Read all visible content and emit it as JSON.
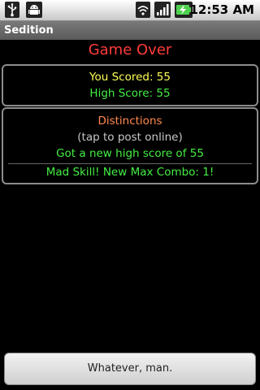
{
  "status_bar": {
    "time": "12:53 AM",
    "icons": [
      "usb-icon",
      "android-debug-icon",
      "wifi-icon",
      "signal-icon",
      "battery-charging-icon"
    ]
  },
  "app": {
    "title": "Sedition"
  },
  "game": {
    "heading": "Game Over",
    "you_scored": "You Scored: 55",
    "high_score": "High Score: 55"
  },
  "distinctions": {
    "title": "Distinctions",
    "hint": "(tap to post online)",
    "items": [
      "Got a new high score of 55",
      "Mad Skill! New Max Combo: 1!"
    ]
  },
  "footer": {
    "button_label": "Whatever, man."
  }
}
